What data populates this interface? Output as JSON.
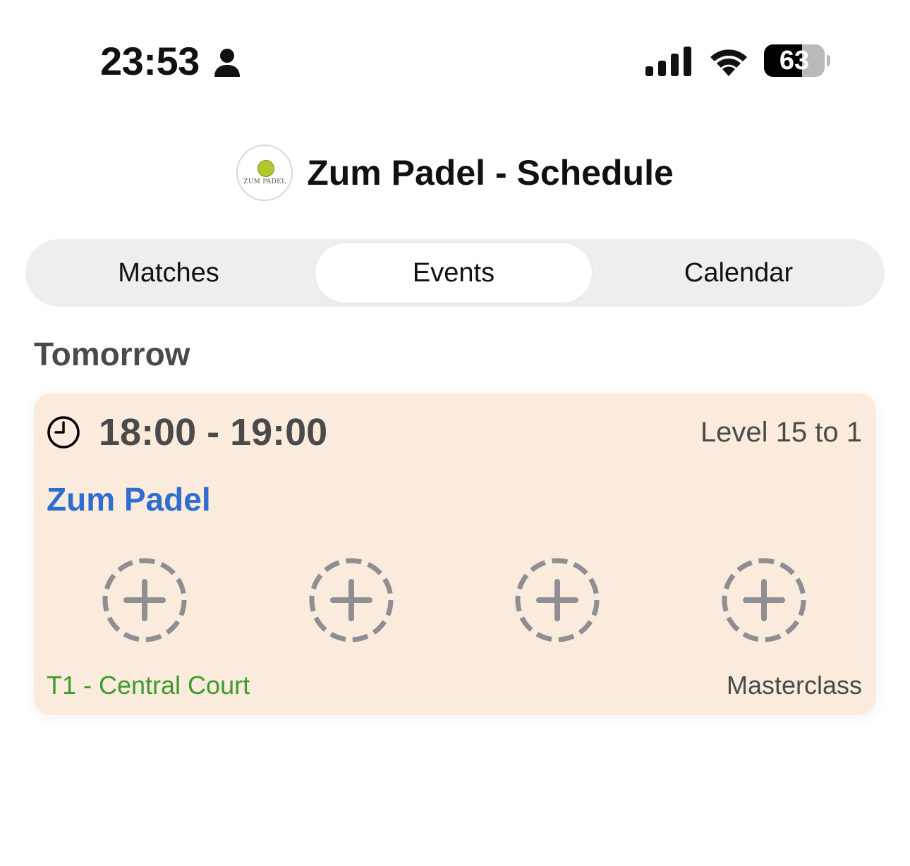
{
  "status_bar": {
    "time": "23:53",
    "battery_level": "63",
    "battery_fraction": 0.63,
    "icons": [
      "person-icon",
      "cellular-signal-icon",
      "wifi-icon",
      "battery-icon"
    ]
  },
  "header": {
    "title": "Zum Padel - Schedule",
    "logo_icon": "zum-padel-logo",
    "logo_text": "ZUM PADEL"
  },
  "tabs": [
    {
      "label": "Matches",
      "active": false
    },
    {
      "label": "Events",
      "active": true
    },
    {
      "label": "Calendar",
      "active": false
    }
  ],
  "section": {
    "title": "Tomorrow"
  },
  "event": {
    "time_range": "18:00 - 19:00",
    "level": "Level 15 to 1",
    "club": "Zum Padel",
    "court": "T1 - Central Court",
    "type": "Masterclass",
    "open_slots": 4,
    "slot_icon": "add-player-dashed-circle-icon"
  },
  "colors": {
    "card_background": "#faebdc",
    "club_link": "#2f6dcf",
    "court_text": "#3e9a29",
    "segment_background": "#eeeeee",
    "slot_icon_gray": "#8e8e93"
  }
}
